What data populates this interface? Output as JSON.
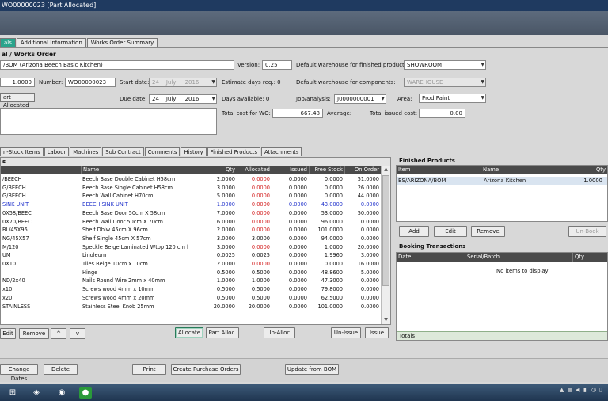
{
  "window": {
    "title": "WO00000023 [Part Allocated]"
  },
  "tabs": [
    {
      "label": "als"
    },
    {
      "label": "Additional Information"
    },
    {
      "label": "Works Order Summary"
    }
  ],
  "header": {
    "section_title": "al / Works Order",
    "bom_value": "/BOM  (Arizona Beech Basic Kitchen)",
    "version_label": "Version:",
    "version_value": "0.25",
    "wh_finished_label": "Default warehouse for finished products:",
    "wh_finished_value": "SHOWROOM",
    "qty_value": "1.0000",
    "number_label": "Number:",
    "number_value": "WO00000023",
    "start_label": "Start date:",
    "start_day": "24",
    "start_month": "July",
    "start_year": "2016",
    "est_days_label": "Estimate days req.: 0",
    "wh_components_label": "Default warehouse for components:",
    "wh_components_value": "WAREHOUSE",
    "status_button": "art Allocated",
    "due_label": "Due date:",
    "due_day": "24",
    "due_month": "July",
    "due_year": "2016",
    "days_avail_label": "Days available: 0",
    "job_label": "Job/analysis:",
    "job_value": "J0000000001",
    "area_label": "Area:",
    "area_value": "Prod Paint",
    "total_cost_label": "Total cost for WO:",
    "total_cost_value": "667.48",
    "average_label": "Average:",
    "total_issued_label": "Total issued cost:",
    "total_issued_value": "0.00"
  },
  "subtabs": [
    {
      "label": "n-Stock Items"
    },
    {
      "label": "Labour"
    },
    {
      "label": "Machines"
    },
    {
      "label": "Sub Contract"
    },
    {
      "label": "Comments"
    },
    {
      "label": "History"
    },
    {
      "label": "Finished Products"
    },
    {
      "label": "Attachments"
    }
  ],
  "grid": {
    "caption": "s",
    "columns": [
      "",
      "Name",
      "Qty",
      "Allocated",
      "Issued",
      "Free Stock",
      "On Order"
    ],
    "rows": [
      {
        "code": "/BEECH",
        "name": "Beech Base Double Cabinet H58cm",
        "qty": "2.0000",
        "allocated": "0.0000",
        "issued": "0.0000",
        "free": "0.0000",
        "order": "51.0000",
        "alloc_style": "red",
        "row_style": ""
      },
      {
        "code": "G/BEECH",
        "name": "Beech Base Single Cabinet H58cm",
        "qty": "3.0000",
        "allocated": "0.0000",
        "issued": "0.0000",
        "free": "0.0000",
        "order": "26.0000",
        "alloc_style": "red",
        "row_style": ""
      },
      {
        "code": "G/BEECH",
        "name": "Beech Wall Cabinet H70cm",
        "qty": "5.0000",
        "allocated": "0.0000",
        "issued": "0.0000",
        "free": "0.0000",
        "order": "44.0000",
        "alloc_style": "red",
        "row_style": ""
      },
      {
        "code": "SINK UNIT",
        "name": "BEECH SINK UNIT",
        "qty": "1.0000",
        "allocated": "0.0000",
        "issued": "0.0000",
        "free": "43.0000",
        "order": "0.0000",
        "alloc_style": "red",
        "row_style": "blue"
      },
      {
        "code": "0X58/BEEC",
        "name": "Beech Base Door 50cm X 58cm",
        "qty": "7.0000",
        "allocated": "0.0000",
        "issued": "0.0000",
        "free": "53.0000",
        "order": "50.0000",
        "alloc_style": "red",
        "row_style": ""
      },
      {
        "code": "0X70/BEEC",
        "name": "Beech Wall Door 50cm X 70cm",
        "qty": "6.0000",
        "allocated": "0.0000",
        "issued": "0.0000",
        "free": "96.0000",
        "order": "0.0000",
        "alloc_style": "red",
        "row_style": ""
      },
      {
        "code": "BL/45X96",
        "name": "Shelf Dblw 45cm X 96cm",
        "qty": "2.0000",
        "allocated": "0.0000",
        "issued": "0.0000",
        "free": "101.0000",
        "order": "0.0000",
        "alloc_style": "red",
        "row_style": ""
      },
      {
        "code": "NG/45X57",
        "name": "Shelf  Single 45cm X 57cm",
        "qty": "3.0000",
        "allocated": "3.0000",
        "issued": "0.0000",
        "free": "94.0000",
        "order": "0.0000",
        "alloc_style": "",
        "row_style": ""
      },
      {
        "code": "M/120",
        "name": "Speckle Beige Laminated Wtop 120 cm l...",
        "qty": "3.0000",
        "allocated": "0.0000",
        "issued": "0.0000",
        "free": "1.0000",
        "order": "20.0000",
        "alloc_style": "red",
        "row_style": ""
      },
      {
        "code": "UM",
        "name": "Linoleum",
        "qty": "0.0025",
        "allocated": "0.0025",
        "issued": "0.0000",
        "free": "1.9960",
        "order": "3.0000",
        "alloc_style": "",
        "row_style": ""
      },
      {
        "code": "0X10",
        "name": "Tiles Beige 10cm x 10cm",
        "qty": "2.0000",
        "allocated": "0.0000",
        "issued": "0.0000",
        "free": "0.0000",
        "order": "16.0000",
        "alloc_style": "red",
        "row_style": ""
      },
      {
        "code": "",
        "name": "Hinge",
        "qty": "0.5000",
        "allocated": "0.5000",
        "issued": "0.0000",
        "free": "48.8600",
        "order": "5.0000",
        "alloc_style": "",
        "row_style": ""
      },
      {
        "code": "ND/2x40",
        "name": "Nails Round Wire 2mm x 40mm",
        "qty": "1.0000",
        "allocated": "1.0000",
        "issued": "0.0000",
        "free": "47.3000",
        "order": "0.0000",
        "alloc_style": "",
        "row_style": ""
      },
      {
        "code": "x10",
        "name": "Screws wood 4mm x 10mm",
        "qty": "0.5000",
        "allocated": "0.5000",
        "issued": "0.0000",
        "free": "79.8000",
        "order": "0.0000",
        "alloc_style": "",
        "row_style": ""
      },
      {
        "code": "x20",
        "name": "Screws wood 4mm x 20mm",
        "qty": "0.5000",
        "allocated": "0.5000",
        "issued": "0.0000",
        "free": "62.5000",
        "order": "0.0000",
        "alloc_style": "",
        "row_style": ""
      },
      {
        "code": "STAINLESS",
        "name": "Stainless Steel Knob 25mm",
        "qty": "20.0000",
        "allocated": "20.0000",
        "issued": "0.0000",
        "free": "101.0000",
        "order": "0.0000",
        "alloc_style": "",
        "row_style": ""
      }
    ]
  },
  "grid_buttons": {
    "edit": "Edit",
    "remove": "Remove",
    "up": "^",
    "down": "v",
    "allocate": "Allocate",
    "part_alloc": "Part Alloc.",
    "un_alloc": "Un-Alloc.",
    "un_issue": "Un-Issue",
    "issue": "Issue"
  },
  "finished_products": {
    "caption": "Finished Products",
    "columns": [
      "Item",
      "Name",
      "Qty"
    ],
    "row": {
      "item": "BS/ARIZONA/BOM",
      "name": "Arizona Kitchen",
      "qty": "1.0000"
    },
    "add": "Add",
    "edit": "Edit",
    "remove": "Remove",
    "unbook": "Un-Book"
  },
  "booking": {
    "caption": "Booking Transactions",
    "columns": [
      "Date",
      "Serial/Batch",
      "Qty"
    ],
    "empty": "No items to display",
    "totals": "Totals"
  },
  "bottom_buttons": {
    "change_dates": "Change Dates",
    "delete": "Delete",
    "print": "Print",
    "create_po": "Create Purchase Orders",
    "update_bom": "Update from BOM"
  },
  "colors": {
    "accent_tab": "#2aa48c",
    "alert_red": "#d42020",
    "titlebar": "#1f3a60"
  }
}
